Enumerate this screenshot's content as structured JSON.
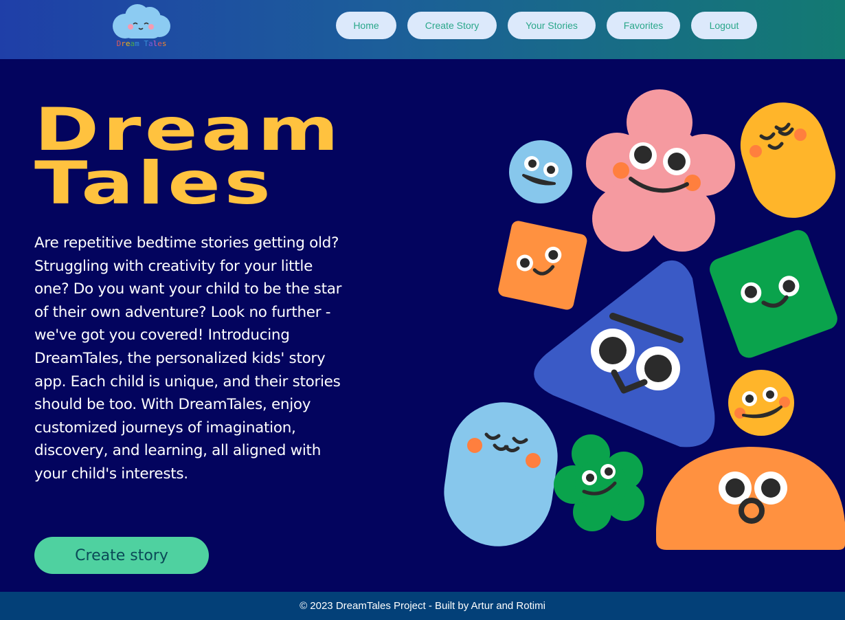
{
  "header": {
    "logo_text": [
      "D",
      "r",
      "e",
      "a",
      "m",
      " ",
      "T",
      "a",
      "l",
      "e",
      "s"
    ],
    "logo_colors": [
      "#e25a5a",
      "#f08a2c",
      "#e8b81a",
      "#4aa84a",
      "#3a8fd8",
      "#ffffff",
      "#3a8fd8",
      "#7a5ad8",
      "#d85ab8",
      "#e25a5a",
      "#f08a2c"
    ]
  },
  "nav": {
    "home": "Home",
    "create_story": "Create Story",
    "your_stories": "Your Stories",
    "favorites": "Favorites",
    "logout": "Logout"
  },
  "hero": {
    "title_line1": "Dream",
    "title_line2": "Tales",
    "description": "Are repetitive bedtime stories getting old? Struggling with creativity for your little one? Do you want your child to be the star of their own adventure? Look no further - we've got you covered! Introducing DreamTales, the personalized kids' story app. Each child is unique, and their stories should be too. With DreamTales, enjoy customized journeys of imagination, discovery, and learning, all aligned with your child's interests.",
    "cta_label": "Create story"
  },
  "footer": {
    "text": "© 2023 DreamTales Project - Built by Artur and Rotimi"
  },
  "colors": {
    "background": "#03045e",
    "title": "#ffc23f",
    "nav_button": "#dce9fb",
    "nav_text": "#2aa78a",
    "cta": "#4fd1a0",
    "footer": "#034078"
  }
}
